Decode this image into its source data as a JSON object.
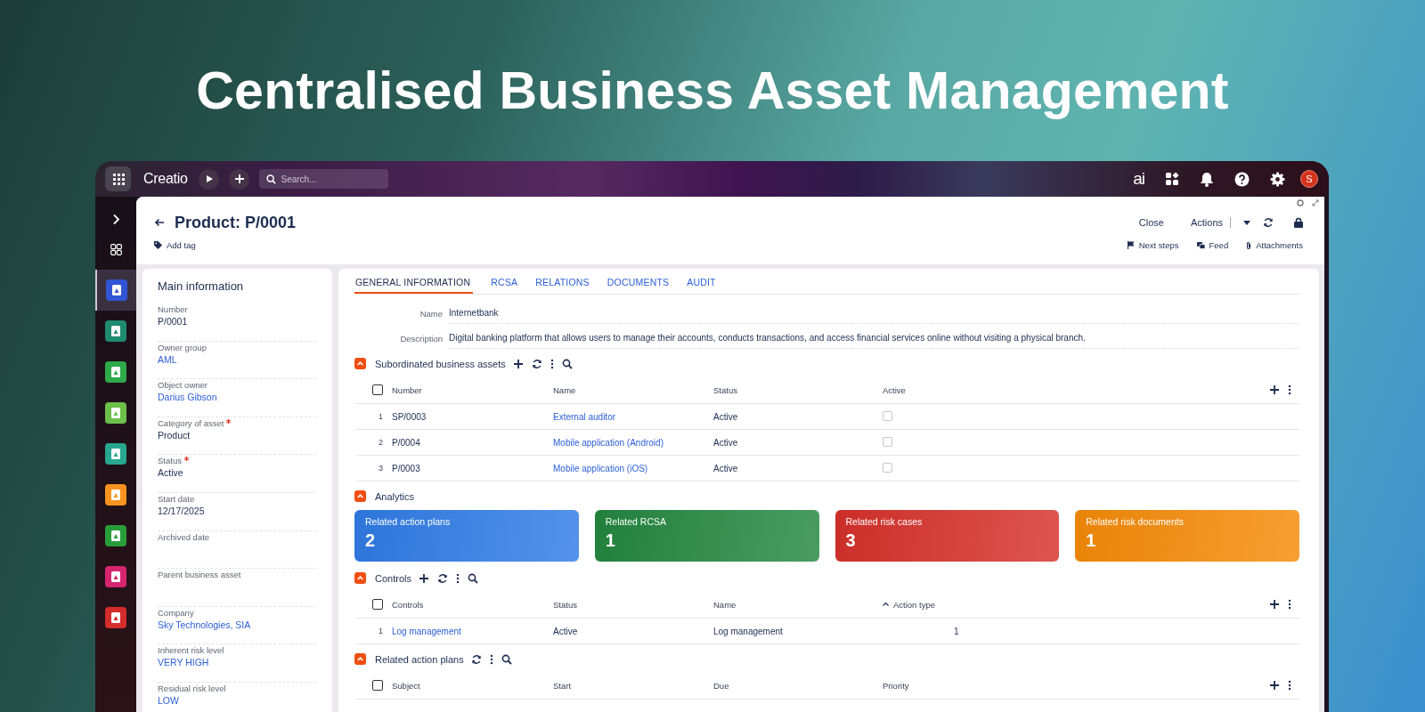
{
  "headline": "Centralised Business Asset Management",
  "topbar": {
    "logo": "Creatio",
    "search": {
      "placeholder": "Search..."
    },
    "ai_label": "ai",
    "avatar": "S"
  },
  "rail": {
    "items": [
      {
        "color": "#2f55d4",
        "selected": true
      },
      {
        "color": "#1f8a70",
        "selected": false
      },
      {
        "color": "#2eaa4a",
        "selected": false
      },
      {
        "color": "#6cc04a",
        "selected": false
      },
      {
        "color": "#27a88f",
        "selected": false
      },
      {
        "color": "#f7931e",
        "selected": false
      },
      {
        "color": "#2a9d3a",
        "selected": false
      },
      {
        "color": "#d6246e",
        "selected": false
      },
      {
        "color": "#d42b2b",
        "selected": false
      }
    ]
  },
  "record": {
    "title": "Product: P/0001",
    "add_tag": "Add tag",
    "close_button": "Close",
    "actions_button": "Actions",
    "links": [
      {
        "kind": "flag",
        "label": "Next steps"
      },
      {
        "kind": "feed",
        "label": "Feed"
      },
      {
        "kind": "attachment",
        "label": "Attachments"
      }
    ]
  },
  "main_info": {
    "title": "Main information",
    "fields": [
      {
        "label": "Number",
        "value": "P/0001",
        "kind": "text",
        "required": false
      },
      {
        "label": "Owner group",
        "value": "AML",
        "kind": "link",
        "required": false
      },
      {
        "label": "Object owner",
        "value": "Darius Gibson",
        "kind": "link",
        "required": false
      },
      {
        "label": "Category of asset",
        "value": "Product",
        "kind": "text",
        "required": true
      },
      {
        "label": "Status",
        "value": "Active",
        "kind": "text",
        "required": true
      },
      {
        "label": "Start date",
        "value": "12/17/2025",
        "kind": "text",
        "required": false
      },
      {
        "label": "Archived date",
        "required": false
      },
      {
        "label": "Parent business asset",
        "required": false
      },
      {
        "label": "Company",
        "value": "Sky Technologies, SIA",
        "kind": "link",
        "required": false
      },
      {
        "label": "Inherent risk level",
        "value": "VERY HIGH",
        "kind": "link",
        "required": false
      },
      {
        "label": "Residual risk level",
        "value": "LOW",
        "kind": "link",
        "required": false
      }
    ]
  },
  "tabs": [
    {
      "label": "GENERAL INFORMATION",
      "selected": true
    },
    {
      "label": "RCSA",
      "selected": false
    },
    {
      "label": "RELATIONS",
      "selected": false
    },
    {
      "label": "DOCUMENTS",
      "selected": false
    },
    {
      "label": "AUDIT",
      "selected": false
    }
  ],
  "general_fields": [
    {
      "label": "Name",
      "value": "Internetbank"
    },
    {
      "label": "Description",
      "value": "Digital banking platform that allows users to manage their accounts, conducts transactions, and access financial services online without visiting a physical branch."
    }
  ],
  "sections": [
    {
      "kind": "table",
      "title": "Subordinated business assets",
      "expanded": true,
      "tools": [
        {
          "kind": "add"
        },
        {
          "kind": "refresh"
        },
        {
          "kind": "more"
        },
        {
          "kind": "search"
        }
      ],
      "select_all_checked": false,
      "columns": [
        {
          "label": "Number"
        },
        {
          "label": "Name"
        },
        {
          "label": "Status"
        },
        {
          "label": "Active"
        }
      ],
      "rows": [
        {
          "index": "1",
          "selected": false,
          "cells": [
            {
              "kind": "text",
              "text": "SP/0003"
            },
            {
              "kind": "link",
              "text": "External auditor"
            },
            {
              "kind": "text",
              "text": "Active"
            },
            {
              "kind": "checkbox",
              "checked": false
            }
          ]
        },
        {
          "index": "2",
          "selected": false,
          "cells": [
            {
              "kind": "text",
              "text": "P/0004"
            },
            {
              "kind": "link",
              "text": "Mobile application (Android)"
            },
            {
              "kind": "text",
              "text": "Active"
            },
            {
              "kind": "checkbox",
              "checked": false
            }
          ]
        },
        {
          "index": "3",
          "selected": false,
          "cells": [
            {
              "kind": "text",
              "text": "P/0003"
            },
            {
              "kind": "link",
              "text": "Mobile application (iOS)"
            },
            {
              "kind": "text",
              "text": "Active"
            },
            {
              "kind": "checkbox",
              "checked": false
            }
          ]
        }
      ]
    },
    {
      "kind": "cards",
      "title": "Analytics",
      "expanded": true,
      "cards": [
        {
          "label": "Related action plans",
          "value": "2",
          "color": "#2f7be6"
        },
        {
          "label": "Related RCSA",
          "value": "1",
          "color": "#23863f"
        },
        {
          "label": "Related risk cases",
          "value": "3",
          "color": "#d6302a"
        },
        {
          "label": "Related risk documents",
          "value": "1",
          "color": "#f58a07"
        }
      ]
    },
    {
      "kind": "table",
      "title": "Controls",
      "expanded": true,
      "tools": [
        {
          "kind": "add"
        },
        {
          "kind": "refresh"
        },
        {
          "kind": "more"
        },
        {
          "kind": "search"
        }
      ],
      "select_all_checked": false,
      "columns": [
        {
          "label": "Controls"
        },
        {
          "label": "Status"
        },
        {
          "label": "Name"
        },
        {
          "label": "Action type",
          "sorted": true
        }
      ],
      "rows": [
        {
          "index": "1",
          "selected": false,
          "cells": [
            {
              "kind": "link",
              "text": "Log management"
            },
            {
              "kind": "text",
              "text": "Active"
            },
            {
              "kind": "text",
              "text": "Log management"
            },
            {
              "kind": "number",
              "text": "1"
            }
          ]
        }
      ]
    },
    {
      "kind": "table",
      "title": "Related action plans",
      "expanded": true,
      "tools": [
        {
          "kind": "refresh"
        },
        {
          "kind": "more"
        },
        {
          "kind": "search"
        }
      ],
      "select_all_checked": false,
      "columns": [
        {
          "label": "Subject"
        },
        {
          "label": "Start"
        },
        {
          "label": "Due"
        },
        {
          "label": "Priority"
        }
      ]
    }
  ]
}
